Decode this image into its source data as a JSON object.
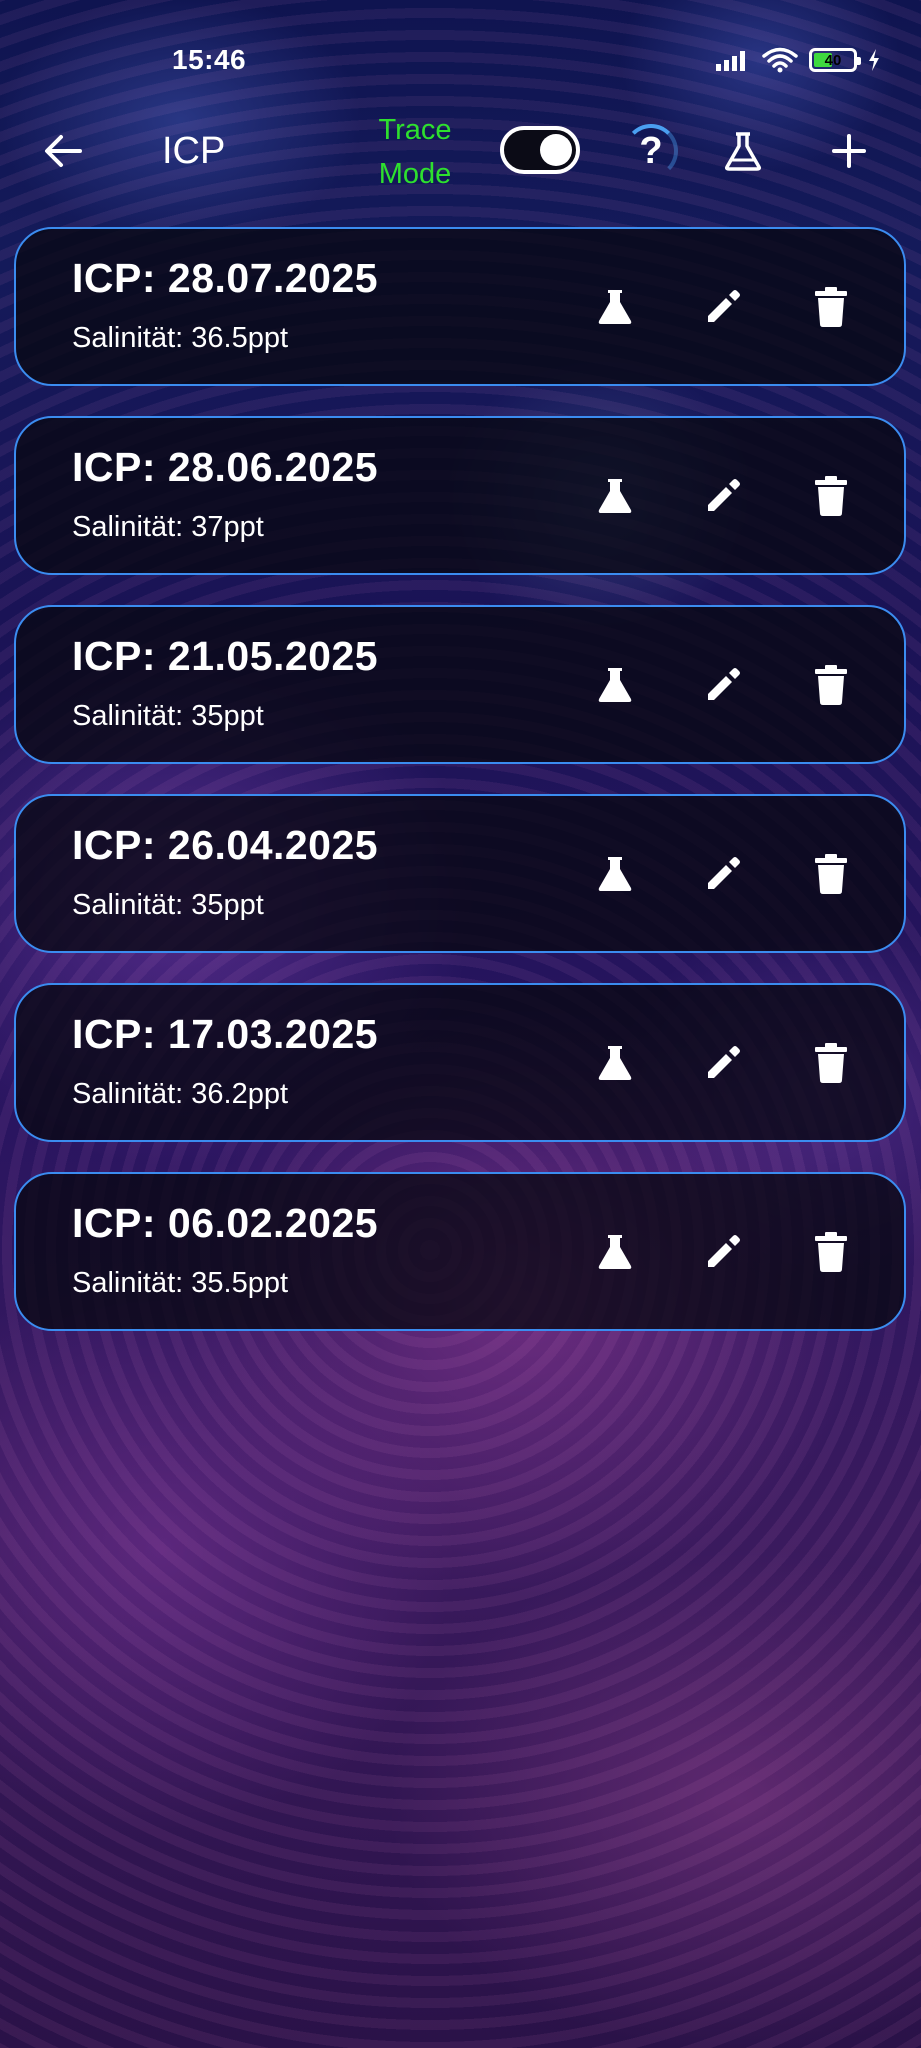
{
  "status_bar": {
    "time": "15:46",
    "battery_level": "40",
    "icons": [
      "signal-icon",
      "wifi-icon",
      "battery-icon",
      "charging-icon"
    ]
  },
  "app_bar": {
    "back_icon": "arrow-left-icon",
    "title": "ICP",
    "trace_mode_label_line1": "Trace",
    "trace_mode_label_line2": "Mode",
    "trace_mode_on": true,
    "help_label": "?",
    "flask_icon": "flask-icon",
    "add_icon": "plus-icon"
  },
  "colors": {
    "accent_green": "#2ee02e",
    "card_border": "#3b8cf0",
    "card_bg": "#080812"
  },
  "entries": [
    {
      "title": "ICP: 28.07.2025",
      "salinity": "Salinität: 36.5ppt"
    },
    {
      "title": "ICP: 28.06.2025",
      "salinity": "Salinität: 37ppt"
    },
    {
      "title": "ICP: 21.05.2025",
      "salinity": "Salinität: 35ppt"
    },
    {
      "title": "ICP: 26.04.2025",
      "salinity": "Salinität: 35ppt"
    },
    {
      "title": "ICP: 17.03.2025",
      "salinity": "Salinität: 36.2ppt"
    },
    {
      "title": "ICP: 06.02.2025",
      "salinity": "Salinität: 35.5ppt"
    }
  ],
  "entry_actions": [
    "flask-icon",
    "edit-icon",
    "delete-icon"
  ]
}
